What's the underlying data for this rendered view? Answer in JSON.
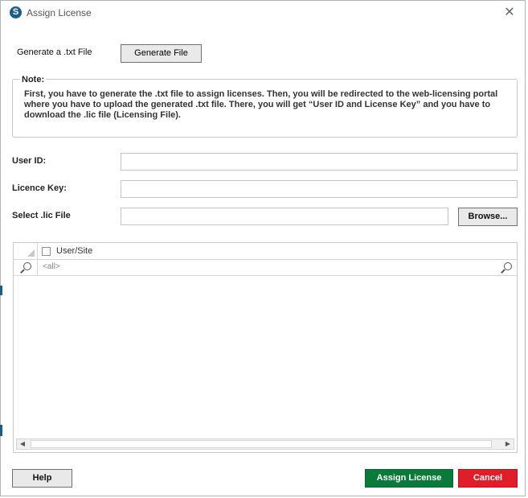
{
  "window": {
    "title": "Assign License",
    "logo_letter": "S",
    "close_glyph": "✕"
  },
  "generate": {
    "label": "Generate a .txt File",
    "button": "Generate File"
  },
  "note": {
    "title": "Note:",
    "text": "First, you have to generate the .txt file to assign licenses. Then, you will be redirected to the web-licensing portal where you have to upload the generated .txt file. There, you will get “User ID and License Key” and you have to download the .lic file (Licensing File)."
  },
  "fields": {
    "user_id_label": "User ID:",
    "user_id_value": "",
    "licence_key_label": "Licence Key:",
    "licence_key_value": "",
    "lic_file_label": "Select .lic File",
    "lic_file_value": "",
    "browse_button": "Browse..."
  },
  "grid": {
    "column_header": "User/Site",
    "header_checked": false,
    "filter_text": "<all>",
    "rows": []
  },
  "footer": {
    "help_button": "Help",
    "assign_button": "Assign License",
    "cancel_button": "Cancel"
  },
  "colors": {
    "assign": "#0a7a3a",
    "cancel": "#e01e2a",
    "logo": "#1b5d8a"
  }
}
